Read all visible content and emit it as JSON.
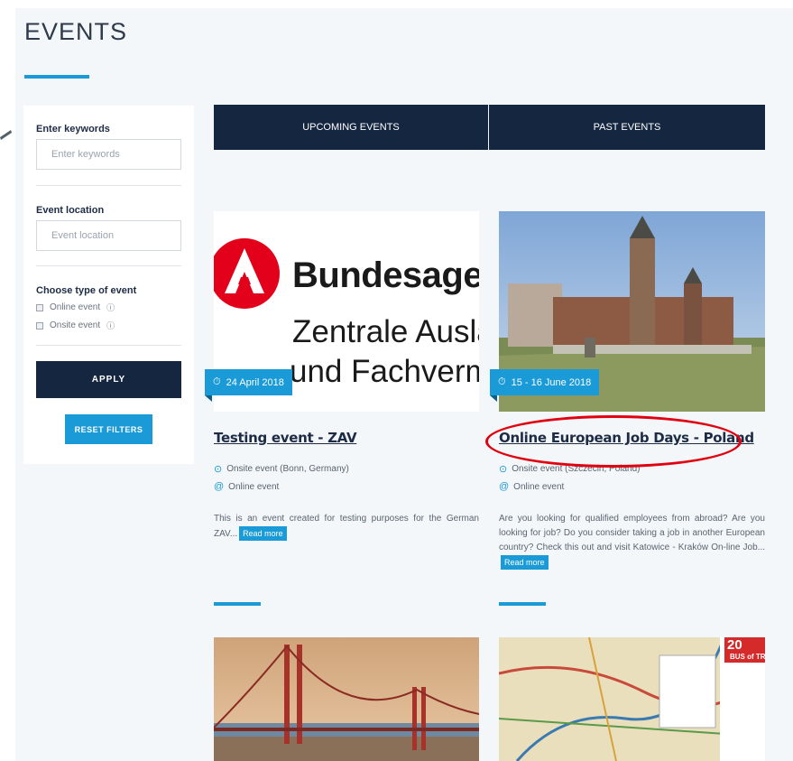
{
  "page": {
    "title": "EVENTS"
  },
  "filters": {
    "keywords_label": "Enter keywords",
    "keywords_placeholder": "Enter keywords",
    "location_label": "Event location",
    "location_placeholder": "Event location",
    "type_label": "Choose type of event",
    "type_online": "Online event",
    "type_onsite": "Onsite event",
    "apply_label": "APPLY",
    "reset_label": "RESET FILTERS"
  },
  "tabs": {
    "upcoming": "UPCOMING EVENTS",
    "past": "PAST EVENTS"
  },
  "cards": [
    {
      "date": "24 April 2018",
      "title": "Testing event - ZAV",
      "onsite": "Onsite event (Bonn, Germany)",
      "online": "Online event",
      "description": "This is an event created for testing purposes for the German ZAV...",
      "read_more": "Read more",
      "image_lines": [
        "Bundesagent",
        "Zentrale Auslar",
        "und Fachvermi"
      ]
    },
    {
      "date": "15 - 16 June 2018",
      "title": "Online European Job Days - Poland",
      "onsite": "Onsite event (Szczecin, Poland)",
      "online": "Online event",
      "description": "Are you looking for qualified employees from abroad? Are you looking for job? Do you consider taking a job in another European country? Check this out and visit Katowice - Kraków On-line Job...",
      "read_more": "Read more"
    }
  ],
  "map_card": {
    "badge_number": "20",
    "badge_text": "BUS of TR"
  },
  "colors": {
    "accent": "#1a9ad6",
    "navy": "#152641",
    "highlight": "#e0000f"
  }
}
